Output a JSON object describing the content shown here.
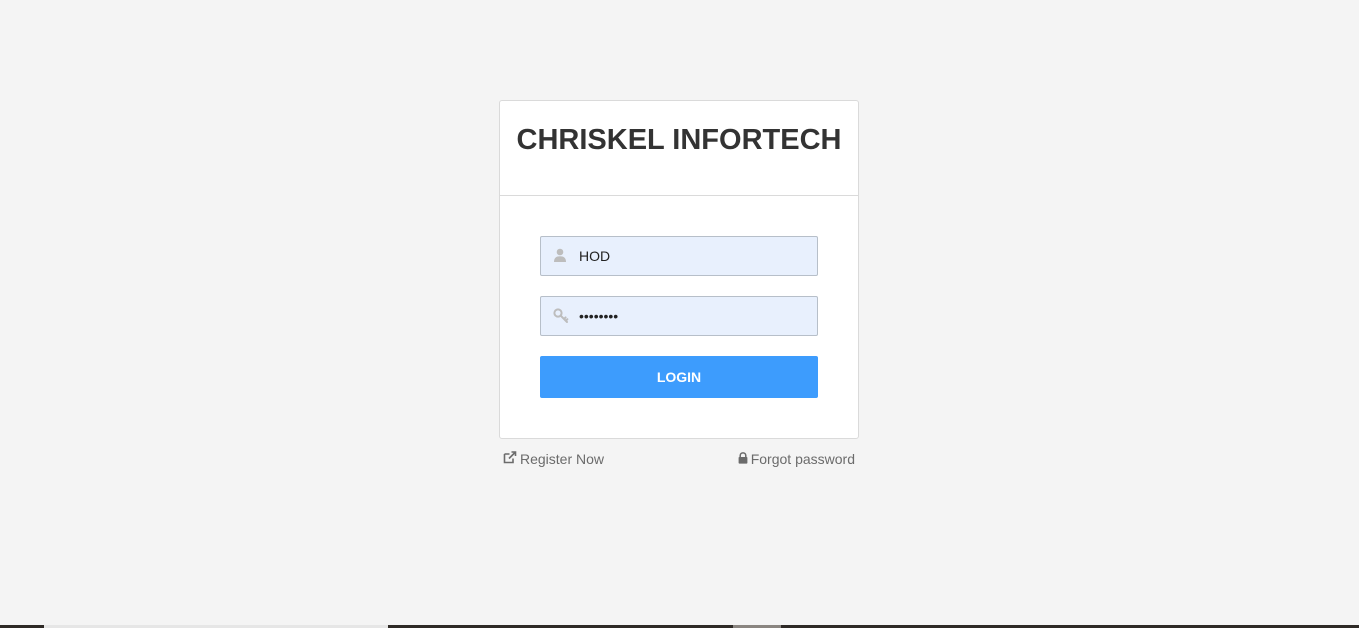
{
  "header": {
    "title": "CHRISKEL INFORTECH"
  },
  "form": {
    "username": {
      "value": "HOD",
      "icon": "user-icon"
    },
    "password": {
      "value": "••••••••",
      "icon": "key-icon"
    },
    "login_label": "LOGIN"
  },
  "links": {
    "register": {
      "label": "Register Now",
      "icon": "external-link-icon"
    },
    "forgot": {
      "label": "Forgot password",
      "icon": "lock-icon"
    }
  },
  "colors": {
    "accent": "#3d9cfd",
    "background": "#f4f4f4",
    "input_fill": "#e8f0fd"
  }
}
